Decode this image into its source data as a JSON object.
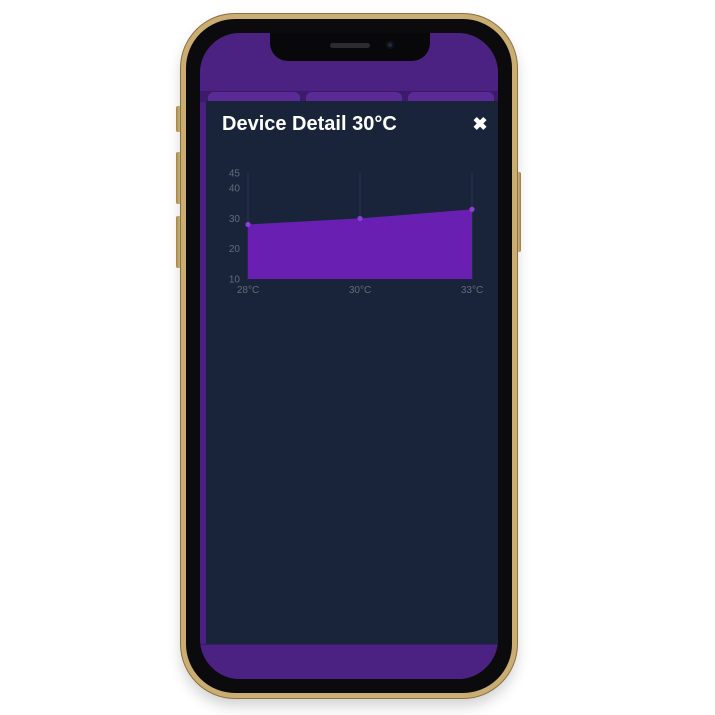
{
  "modal": {
    "title": "Device Detail 30°C",
    "close_icon": "close-icon",
    "close_glyph": "✖"
  },
  "colors": {
    "frame": "#c9ad72",
    "header": "#4b2281",
    "panel": "#19243a",
    "series_fill": "#6a1fb3"
  },
  "chart_data": {
    "type": "area",
    "categories": [
      "28°C",
      "30°C",
      "33°C"
    ],
    "x": [
      "28°C",
      "30°C",
      "33°C"
    ],
    "series": [
      {
        "values": [
          28,
          30,
          33
        ]
      }
    ],
    "yticks": [
      10,
      20,
      30,
      40,
      45
    ],
    "ylim": [
      10,
      45
    ],
    "grid": true,
    "legend": "none"
  }
}
